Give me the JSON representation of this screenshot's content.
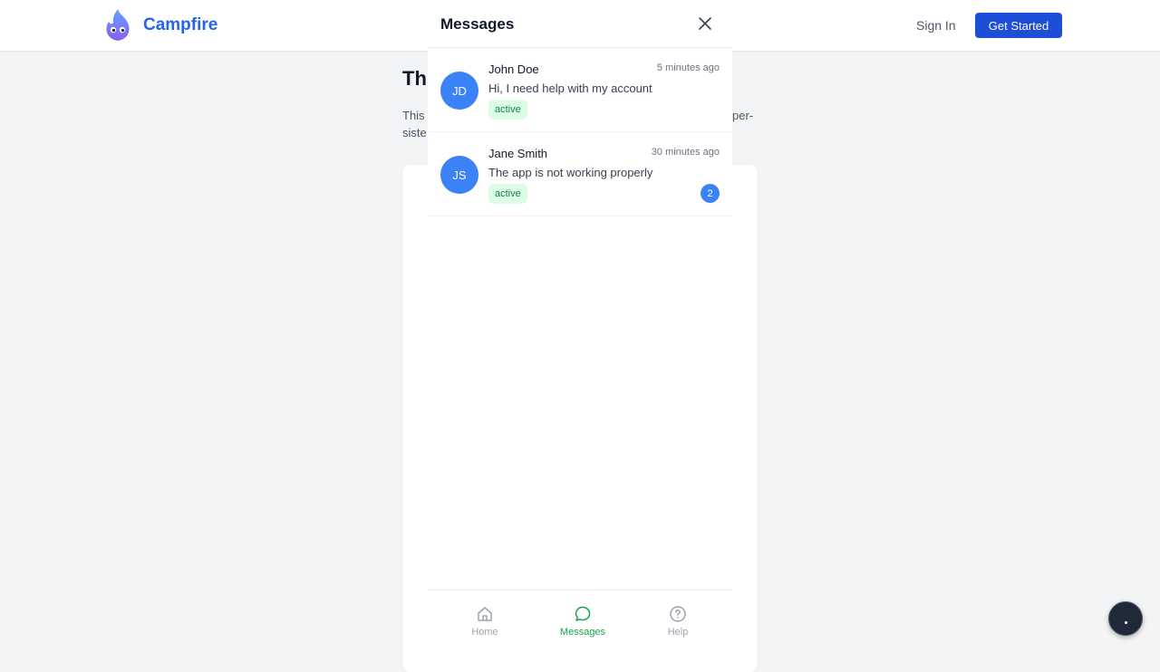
{
  "header": {
    "brand_name": "Campfire",
    "sign_in_label": "Sign In",
    "get_started_label": "Get Started"
  },
  "background_page": {
    "title_fragment": "Thr",
    "desc_left": "This\nsiste",
    "desc_right_fragment": "per-"
  },
  "messages_panel": {
    "title": "Messages",
    "conversations": [
      {
        "initials": "JD",
        "name": "John Doe",
        "time": "5 minutes ago",
        "preview": "Hi, I need help with my account",
        "status": "active",
        "unread": null
      },
      {
        "initials": "JS",
        "name": "Jane Smith",
        "time": "30 minutes ago",
        "preview": "The app is not working properly",
        "status": "active",
        "unread": "2"
      }
    ],
    "nav": [
      {
        "label": "Home",
        "icon": "home-icon",
        "active": false
      },
      {
        "label": "Messages",
        "icon": "chat-bubble-icon",
        "active": true
      },
      {
        "label": "Help",
        "icon": "help-circle-icon",
        "active": false
      }
    ]
  },
  "colors": {
    "primary": "#1d4ed8",
    "brand_text": "#2563eb",
    "avatar_bg": "#3b82f6",
    "active_nav": "#16a34a",
    "inactive_nav": "#9ca3af",
    "status_bg": "#dcfce7",
    "status_text": "#15803d"
  }
}
